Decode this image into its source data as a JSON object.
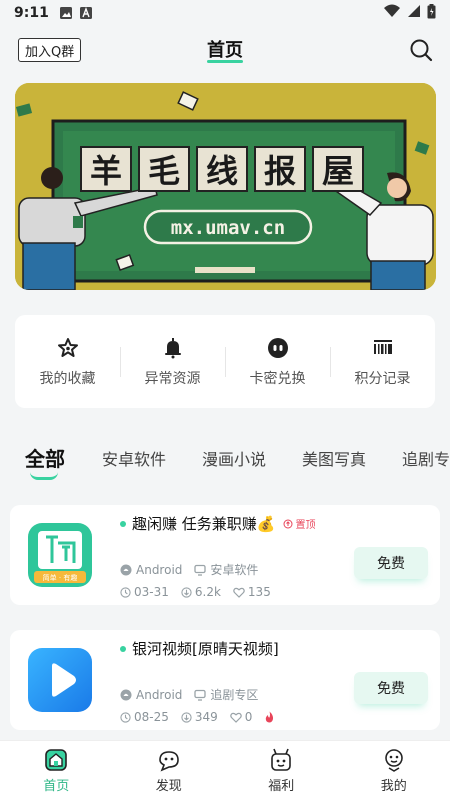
{
  "status_bar": {
    "time": "9:11"
  },
  "header": {
    "join_label": "加入Q群",
    "title": "首页"
  },
  "banner": {
    "title_chars": [
      "羊",
      "毛",
      "线",
      "报",
      "屋"
    ],
    "url": "mx.umav.cn"
  },
  "quick_actions": [
    {
      "label": "我的收藏",
      "icon": "star-icon"
    },
    {
      "label": "异常资源",
      "icon": "bell-icon"
    },
    {
      "label": "卡密兑换",
      "icon": "robot-icon"
    },
    {
      "label": "积分记录",
      "icon": "barcode-icon"
    }
  ],
  "tabs": [
    "全部",
    "安卓软件",
    "漫画小说",
    "美图写真",
    "追剧专"
  ],
  "items": [
    {
      "title": "趣闲赚 任务兼职赚💰",
      "badge": "置顶",
      "platform": "Android",
      "category": "安卓软件",
      "date": "03-31",
      "downloads": "6.2k",
      "likes": "135",
      "action": "免费",
      "icon_text": "简单 · 有趣"
    },
    {
      "title": "银河视频[原晴天视频]",
      "platform": "Android",
      "category": "追剧专区",
      "date": "08-25",
      "downloads": "349",
      "likes": "0",
      "action": "免费"
    }
  ],
  "bottom_nav": [
    {
      "label": "首页",
      "icon": "home-icon"
    },
    {
      "label": "发现",
      "icon": "discover-icon"
    },
    {
      "label": "福利",
      "icon": "gift-icon"
    },
    {
      "label": "我的",
      "icon": "profile-icon"
    }
  ],
  "colors": {
    "accent": "#38d2a0",
    "accent_text": "#2fb787",
    "free_bg": "#e6f8f1",
    "badge": "#e8455a"
  }
}
